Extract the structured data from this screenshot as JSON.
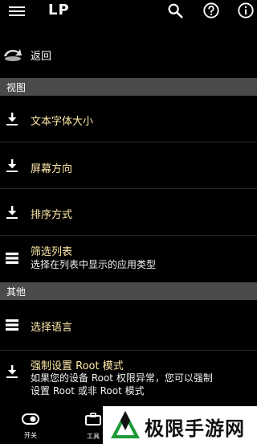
{
  "header": {
    "title": "LP",
    "icons": [
      "menu-icon",
      "search-icon",
      "help-icon",
      "info-icon"
    ]
  },
  "back": {
    "label": "返回"
  },
  "sections": [
    {
      "title": "视图",
      "items": [
        {
          "label": "文本字体大小",
          "icon": "download-icon"
        },
        {
          "label": "屏幕方向",
          "icon": "download-icon"
        },
        {
          "label": "排序方式",
          "icon": "download-icon"
        },
        {
          "label": "筛选列表",
          "sub": "选择在列表中显示的应用类型",
          "icon": "list-icon"
        }
      ]
    },
    {
      "title": "其他",
      "items": [
        {
          "label": "选择语言",
          "icon": "list-icon"
        },
        {
          "label": "强制设置 Root 模式",
          "sub_lines": [
            "如果您的设备 Root 权限异常，您可以强制",
            "设置 Root 或非 Root 模式"
          ],
          "icon": "download-icon"
        }
      ]
    }
  ],
  "bottom_nav": {
    "tabs": [
      {
        "label": "开关",
        "icon": "toggle-icon"
      },
      {
        "label": "工具",
        "icon": "toolbox-icon"
      }
    ]
  },
  "watermark": {
    "text": "极限手游网"
  },
  "colors": {
    "background": "#000000",
    "section_bg": "#4a4a4a",
    "item_label": "#ffe9a8",
    "divider": "#2a2a2a"
  }
}
